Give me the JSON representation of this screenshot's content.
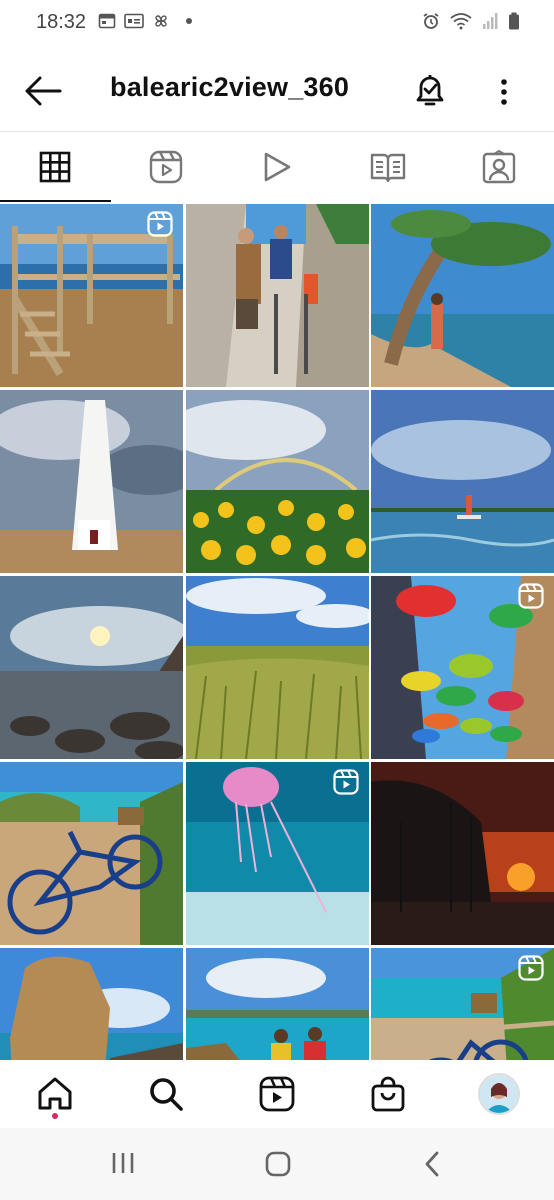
{
  "status_bar": {
    "time": "18:32"
  },
  "header": {
    "username": "balearic2view_360"
  },
  "tabs": [
    {
      "name": "grid"
    },
    {
      "name": "reels"
    },
    {
      "name": "videos"
    },
    {
      "name": "guides"
    },
    {
      "name": "tagged"
    }
  ],
  "posts": [
    {
      "desc": "Wooden lookout stairs by the sea",
      "reel": true
    },
    {
      "desc": "Hikers on rocky trail",
      "reel": false
    },
    {
      "desc": "Woman under a pine tree by the sea",
      "reel": false
    },
    {
      "desc": "White lighthouse under clouds",
      "reel": false
    },
    {
      "desc": "Sunflower field with rainbow",
      "reel": false
    },
    {
      "desc": "Paddle boarder on bay",
      "reel": false
    },
    {
      "desc": "Rocky coastline at sunset",
      "reel": false
    },
    {
      "desc": "Wheat field under blue sky",
      "reel": false
    },
    {
      "desc": "Colorful umbrellas over street",
      "reel": true
    },
    {
      "desc": "Blue bicycle by the beach",
      "reel": false
    },
    {
      "desc": "Jellyfish underwater",
      "reel": true
    },
    {
      "desc": "Harbour silhouette at sunset",
      "reel": false
    },
    {
      "desc": "Rock formation by the sea",
      "reel": false
    },
    {
      "desc": "People on beach",
      "reel": false
    },
    {
      "desc": "Bicycle on coastal path",
      "reel": true
    }
  ],
  "colors": {
    "accent_dot": "#e0245e",
    "text": "#111111"
  }
}
